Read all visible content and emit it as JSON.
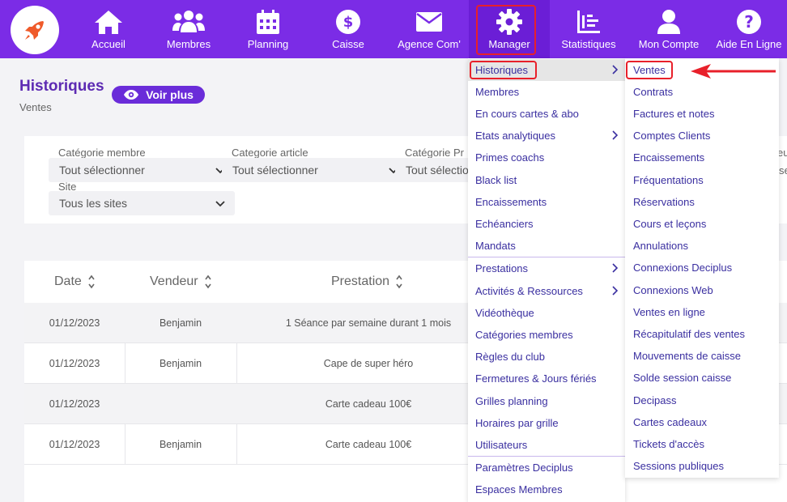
{
  "topbar": {
    "logo_icon": "rocket-icon",
    "items": [
      {
        "label": "Accueil",
        "icon": "home-icon"
      },
      {
        "label": "Membres",
        "icon": "users-icon"
      },
      {
        "label": "Planning",
        "icon": "calendar-icon"
      },
      {
        "label": "Caisse",
        "icon": "dollar-icon"
      },
      {
        "label": "Agence Com'",
        "icon": "envelope-icon"
      },
      {
        "label": "Manager",
        "icon": "gear-icon"
      },
      {
        "label": "Statistiques",
        "icon": "bar-chart-icon"
      },
      {
        "label": "Mon Compte",
        "icon": "user-icon"
      },
      {
        "label": "Aide En Ligne",
        "icon": "help-icon"
      }
    ],
    "active": "Manager"
  },
  "header": {
    "title": "Historiques",
    "voir_plus": "Voir plus",
    "subtitle": "Ventes"
  },
  "filters": {
    "categorie_membre": {
      "label": "Catégorie membre",
      "value": "Tout sélectionner"
    },
    "categorie_article": {
      "label": "Categorie article",
      "value": "Tout sélectionner"
    },
    "categorie_p": {
      "label": "Catégorie Pr",
      "value": "Tout sélection"
    },
    "site": {
      "label": "Site",
      "value": "Tous les sites"
    },
    "partial_right": {
      "label": "eu",
      "value": "se"
    }
  },
  "table": {
    "headers": [
      "Date",
      "Vendeur",
      "Prestation"
    ],
    "rows": [
      {
        "date": "01/12/2023",
        "vendeur": "Benjamin",
        "prestation": "1 Séance par semaine durant 1 mois"
      },
      {
        "date": "01/12/2023",
        "vendeur": "Benjamin",
        "prestation": "Cape de super héro"
      },
      {
        "date": "01/12/2023",
        "vendeur": "",
        "prestation": "Carte cadeau 100€"
      },
      {
        "date": "01/12/2023",
        "vendeur": "Benjamin",
        "prestation": "Carte cadeau 100€"
      }
    ]
  },
  "menu1": {
    "items": [
      {
        "label": "Historiques",
        "submenu": true
      },
      {
        "label": "Membres"
      },
      {
        "label": "En cours cartes & abo"
      },
      {
        "label": "Etats analytiques",
        "submenu": true
      },
      {
        "label": "Primes coachs"
      },
      {
        "label": "Black list"
      },
      {
        "label": "Encaissements"
      },
      {
        "label": "Echéanciers"
      },
      {
        "label": "Mandats"
      },
      {
        "label": "Prestations",
        "submenu": true
      },
      {
        "label": "Activités & Ressources",
        "submenu": true
      },
      {
        "label": "Vidéothèque"
      },
      {
        "label": "Catégories membres"
      },
      {
        "label": "Règles du club"
      },
      {
        "label": "Fermetures & Jours fériés"
      },
      {
        "label": "Grilles planning"
      },
      {
        "label": "Horaires par grille"
      },
      {
        "label": "Utilisateurs"
      },
      {
        "label": "Paramètres Deciplus"
      },
      {
        "label": "Espaces Membres"
      }
    ]
  },
  "menu2": {
    "items": [
      "Ventes",
      "Contrats",
      "Factures et notes",
      "Comptes Clients",
      "Encaissements",
      "Fréquentations",
      "Réservations",
      "Cours et leçons",
      "Annulations",
      "Connexions Deciplus",
      "Connexions Web",
      "Ventes en ligne",
      "Récapitulatif des ventes",
      "Mouvements de caisse",
      "Solde session caisse",
      "Decipass",
      "Cartes cadeaux",
      "Tickets d'accès",
      "Sessions publiques"
    ]
  },
  "colors": {
    "brand": "#7b2ce6",
    "menu_text": "#3a2fa0",
    "highlight_border": "#e8202a"
  }
}
